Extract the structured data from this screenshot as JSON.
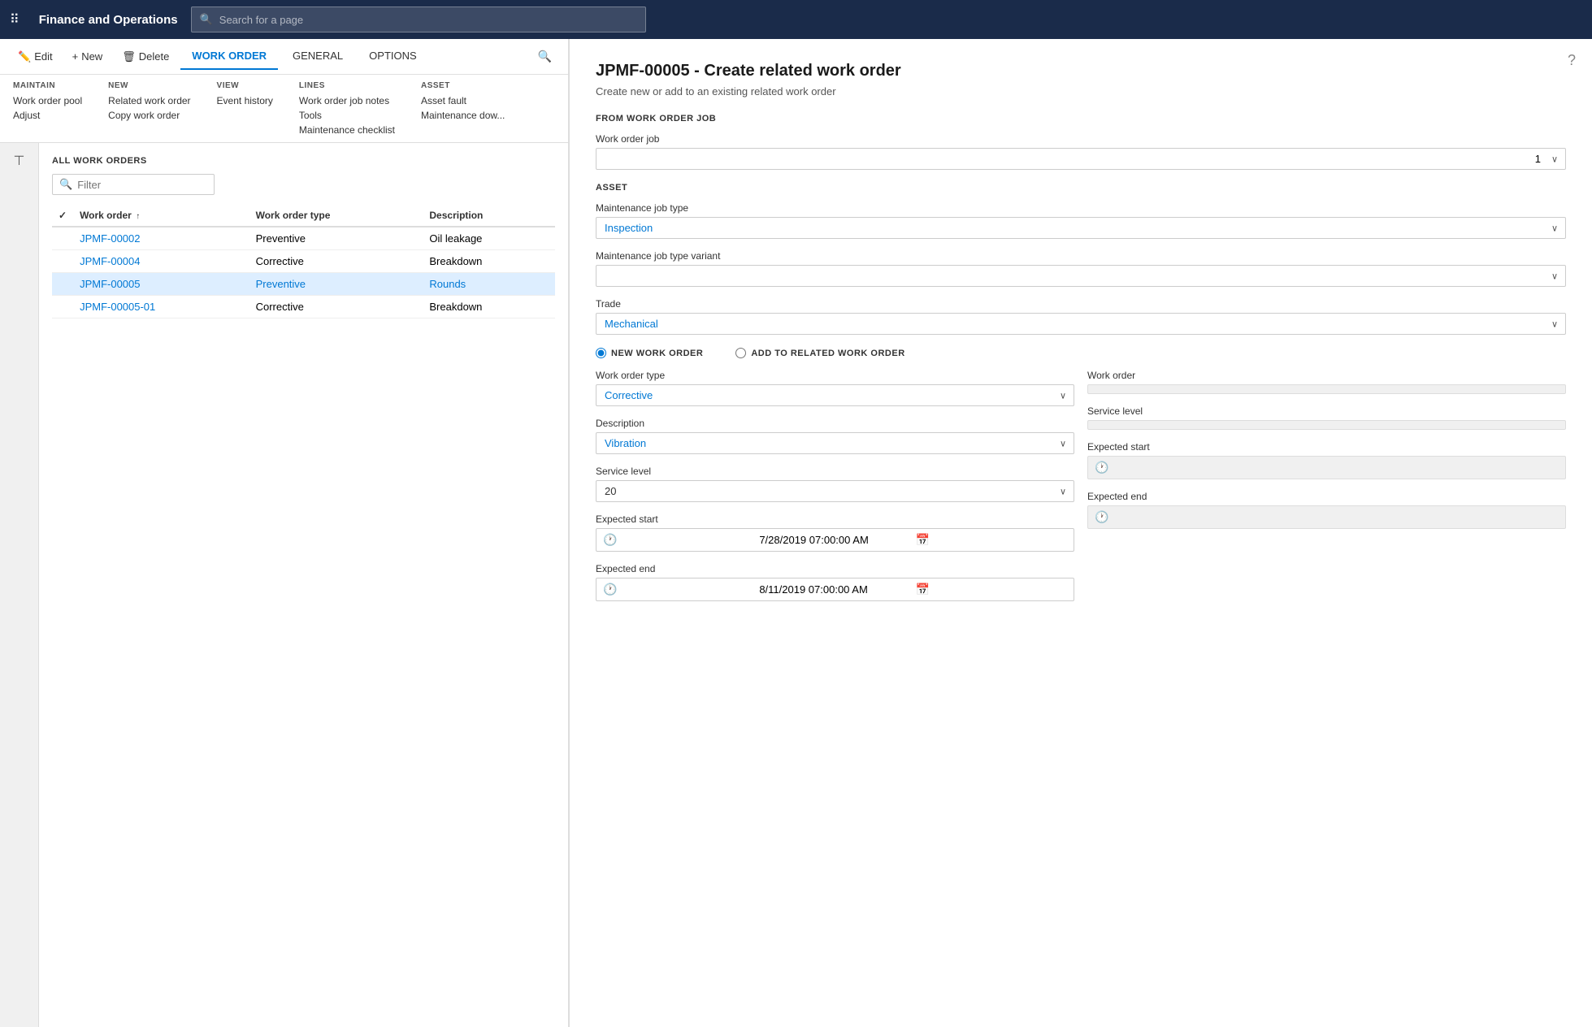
{
  "app": {
    "title": "Finance and Operations",
    "search_placeholder": "Search for a page"
  },
  "ribbon": {
    "edit_label": "Edit",
    "new_label": "New",
    "delete_label": "Delete",
    "tabs": [
      {
        "id": "work_order",
        "label": "WORK ORDER",
        "active": true
      },
      {
        "id": "general",
        "label": "GENERAL",
        "active": false
      },
      {
        "id": "options",
        "label": "OPTIONS",
        "active": false
      }
    ],
    "groups": {
      "maintain": {
        "title": "MAINTAIN",
        "items": [
          "Work order pool",
          "Adjust"
        ]
      },
      "new": {
        "title": "NEW",
        "items": [
          "Related work order",
          "Copy work order"
        ]
      },
      "view": {
        "title": "VIEW",
        "items": [
          "Event history"
        ]
      },
      "lines": {
        "title": "LINES",
        "items": [
          "Work order job notes",
          "Tools",
          "Maintenance checklist"
        ]
      },
      "asset": {
        "title": "ASSET",
        "items": [
          "Asset fault",
          "Maintenance dow..."
        ]
      }
    }
  },
  "list": {
    "header": "ALL WORK ORDERS",
    "filter_placeholder": "Filter",
    "columns": [
      "Work order",
      "Work order type",
      "Description"
    ],
    "rows": [
      {
        "id": "JPMF-00002",
        "type": "Preventive",
        "description": "Oil leakage",
        "selected": false
      },
      {
        "id": "JPMF-00004",
        "type": "Corrective",
        "description": "Breakdown",
        "selected": false
      },
      {
        "id": "JPMF-00005",
        "type": "Preventive",
        "description": "Rounds",
        "selected": true
      },
      {
        "id": "JPMF-00005-01",
        "type": "Corrective",
        "description": "Breakdown",
        "selected": false
      }
    ]
  },
  "dialog": {
    "title": "JPMF-00005 - Create related work order",
    "subtitle": "Create new or add to an existing related work order",
    "sections": {
      "from_work_order_job": {
        "label": "FROM WORK ORDER JOB",
        "work_order_job_label": "Work order job",
        "work_order_job_value": "1"
      },
      "asset": {
        "label": "ASSET",
        "maintenance_job_type_label": "Maintenance job type",
        "maintenance_job_type_value": "Inspection",
        "maintenance_job_type_variant_label": "Maintenance job type variant",
        "trade_label": "Trade",
        "trade_value": "Mechanical"
      }
    },
    "new_work_order": {
      "radio_label": "NEW WORK ORDER",
      "add_to_related_label": "ADD TO RELATED WORK ORDER",
      "work_order_type_label": "Work order type",
      "work_order_type_value": "Corrective",
      "description_label": "Description",
      "description_value": "Vibration",
      "service_level_label": "Service level",
      "service_level_value": "20",
      "expected_start_label": "Expected start",
      "expected_start_value": "7/28/2019 07:00:00 AM",
      "expected_end_label": "Expected end",
      "expected_end_value": "8/11/2019 07:00:00 AM"
    },
    "add_to_related": {
      "work_order_label": "Work order",
      "service_level_label": "Service level",
      "expected_start_label": "Expected start",
      "expected_end_label": "Expected end"
    },
    "help_tooltip": "?"
  }
}
